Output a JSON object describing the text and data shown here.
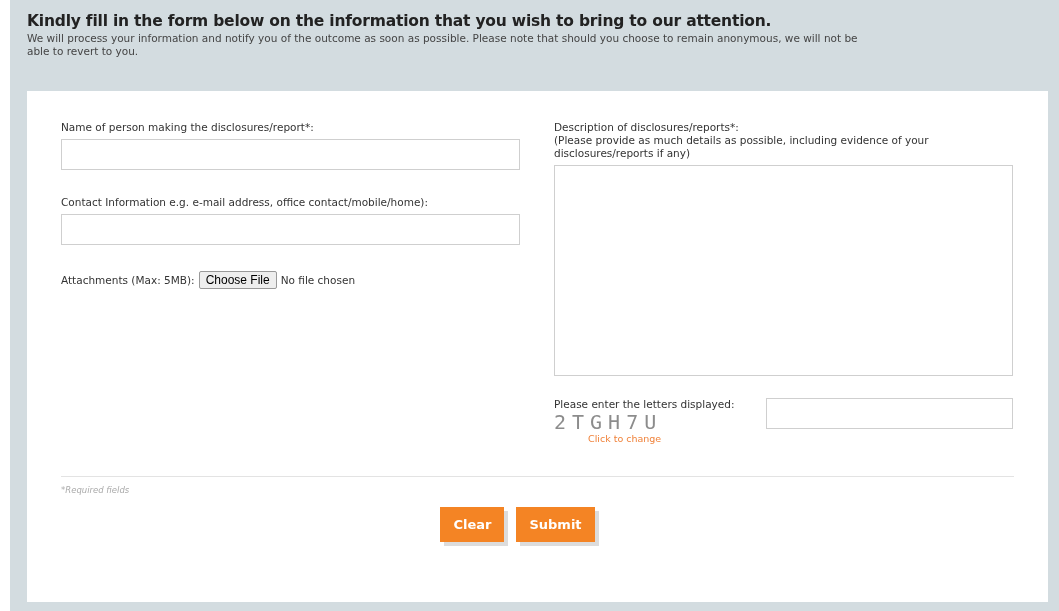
{
  "header": {
    "title": "Kindly fill in the form below on the information that you wish to bring to our attention.",
    "note": "We will process your information and notify you of the outcome as soon as possible. Please note that should you choose to remain anonymous, we will not be able to revert to you."
  },
  "left_fields": [
    {
      "kind": "text",
      "label": "Name of person making the disclosures/report*:"
    },
    {
      "kind": "text",
      "label": "Contact Information e.g. e-mail address, office contact/mobile/home):"
    },
    {
      "kind": "file",
      "label": "Attachments (Max: 5MB):",
      "button": "Choose File",
      "status": "No file chosen"
    }
  ],
  "description": {
    "label": "Description of disclosures/reports*:",
    "hint": "(Please provide as much details as possible, including evidence of your disclosures/reports if any)"
  },
  "captcha": {
    "label": "Please enter the letters displayed:",
    "code": "2TGH7U",
    "link": "Click to change"
  },
  "required_note": "*Required fields",
  "buttons": [
    "Clear",
    "Submit"
  ]
}
